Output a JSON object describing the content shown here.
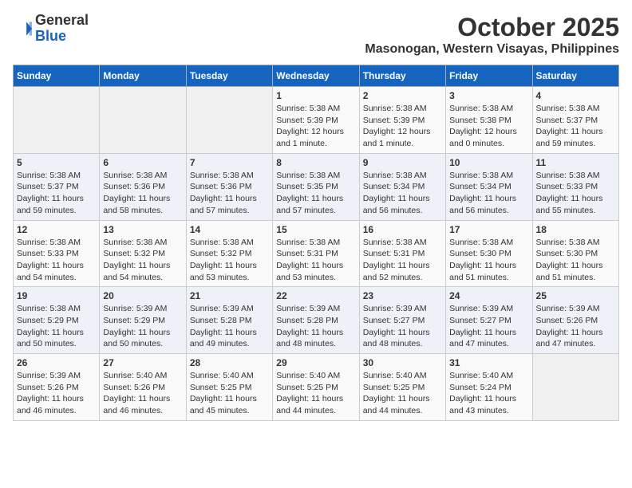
{
  "header": {
    "logo_general": "General",
    "logo_blue": "Blue",
    "month": "October 2025",
    "location": "Masonogan, Western Visayas, Philippines"
  },
  "weekdays": [
    "Sunday",
    "Monday",
    "Tuesday",
    "Wednesday",
    "Thursday",
    "Friday",
    "Saturday"
  ],
  "weeks": [
    [
      {
        "day": "",
        "info": ""
      },
      {
        "day": "",
        "info": ""
      },
      {
        "day": "",
        "info": ""
      },
      {
        "day": "1",
        "info": "Sunrise: 5:38 AM\nSunset: 5:39 PM\nDaylight: 12 hours\nand 1 minute."
      },
      {
        "day": "2",
        "info": "Sunrise: 5:38 AM\nSunset: 5:39 PM\nDaylight: 12 hours\nand 1 minute."
      },
      {
        "day": "3",
        "info": "Sunrise: 5:38 AM\nSunset: 5:38 PM\nDaylight: 12 hours\nand 0 minutes."
      },
      {
        "day": "4",
        "info": "Sunrise: 5:38 AM\nSunset: 5:37 PM\nDaylight: 11 hours\nand 59 minutes."
      }
    ],
    [
      {
        "day": "5",
        "info": "Sunrise: 5:38 AM\nSunset: 5:37 PM\nDaylight: 11 hours\nand 59 minutes."
      },
      {
        "day": "6",
        "info": "Sunrise: 5:38 AM\nSunset: 5:36 PM\nDaylight: 11 hours\nand 58 minutes."
      },
      {
        "day": "7",
        "info": "Sunrise: 5:38 AM\nSunset: 5:36 PM\nDaylight: 11 hours\nand 57 minutes."
      },
      {
        "day": "8",
        "info": "Sunrise: 5:38 AM\nSunset: 5:35 PM\nDaylight: 11 hours\nand 57 minutes."
      },
      {
        "day": "9",
        "info": "Sunrise: 5:38 AM\nSunset: 5:34 PM\nDaylight: 11 hours\nand 56 minutes."
      },
      {
        "day": "10",
        "info": "Sunrise: 5:38 AM\nSunset: 5:34 PM\nDaylight: 11 hours\nand 56 minutes."
      },
      {
        "day": "11",
        "info": "Sunrise: 5:38 AM\nSunset: 5:33 PM\nDaylight: 11 hours\nand 55 minutes."
      }
    ],
    [
      {
        "day": "12",
        "info": "Sunrise: 5:38 AM\nSunset: 5:33 PM\nDaylight: 11 hours\nand 54 minutes."
      },
      {
        "day": "13",
        "info": "Sunrise: 5:38 AM\nSunset: 5:32 PM\nDaylight: 11 hours\nand 54 minutes."
      },
      {
        "day": "14",
        "info": "Sunrise: 5:38 AM\nSunset: 5:32 PM\nDaylight: 11 hours\nand 53 minutes."
      },
      {
        "day": "15",
        "info": "Sunrise: 5:38 AM\nSunset: 5:31 PM\nDaylight: 11 hours\nand 53 minutes."
      },
      {
        "day": "16",
        "info": "Sunrise: 5:38 AM\nSunset: 5:31 PM\nDaylight: 11 hours\nand 52 minutes."
      },
      {
        "day": "17",
        "info": "Sunrise: 5:38 AM\nSunset: 5:30 PM\nDaylight: 11 hours\nand 51 minutes."
      },
      {
        "day": "18",
        "info": "Sunrise: 5:38 AM\nSunset: 5:30 PM\nDaylight: 11 hours\nand 51 minutes."
      }
    ],
    [
      {
        "day": "19",
        "info": "Sunrise: 5:38 AM\nSunset: 5:29 PM\nDaylight: 11 hours\nand 50 minutes."
      },
      {
        "day": "20",
        "info": "Sunrise: 5:39 AM\nSunset: 5:29 PM\nDaylight: 11 hours\nand 50 minutes."
      },
      {
        "day": "21",
        "info": "Sunrise: 5:39 AM\nSunset: 5:28 PM\nDaylight: 11 hours\nand 49 minutes."
      },
      {
        "day": "22",
        "info": "Sunrise: 5:39 AM\nSunset: 5:28 PM\nDaylight: 11 hours\nand 48 minutes."
      },
      {
        "day": "23",
        "info": "Sunrise: 5:39 AM\nSunset: 5:27 PM\nDaylight: 11 hours\nand 48 minutes."
      },
      {
        "day": "24",
        "info": "Sunrise: 5:39 AM\nSunset: 5:27 PM\nDaylight: 11 hours\nand 47 minutes."
      },
      {
        "day": "25",
        "info": "Sunrise: 5:39 AM\nSunset: 5:26 PM\nDaylight: 11 hours\nand 47 minutes."
      }
    ],
    [
      {
        "day": "26",
        "info": "Sunrise: 5:39 AM\nSunset: 5:26 PM\nDaylight: 11 hours\nand 46 minutes."
      },
      {
        "day": "27",
        "info": "Sunrise: 5:40 AM\nSunset: 5:26 PM\nDaylight: 11 hours\nand 46 minutes."
      },
      {
        "day": "28",
        "info": "Sunrise: 5:40 AM\nSunset: 5:25 PM\nDaylight: 11 hours\nand 45 minutes."
      },
      {
        "day": "29",
        "info": "Sunrise: 5:40 AM\nSunset: 5:25 PM\nDaylight: 11 hours\nand 44 minutes."
      },
      {
        "day": "30",
        "info": "Sunrise: 5:40 AM\nSunset: 5:25 PM\nDaylight: 11 hours\nand 44 minutes."
      },
      {
        "day": "31",
        "info": "Sunrise: 5:40 AM\nSunset: 5:24 PM\nDaylight: 11 hours\nand 43 minutes."
      },
      {
        "day": "",
        "info": ""
      }
    ]
  ]
}
